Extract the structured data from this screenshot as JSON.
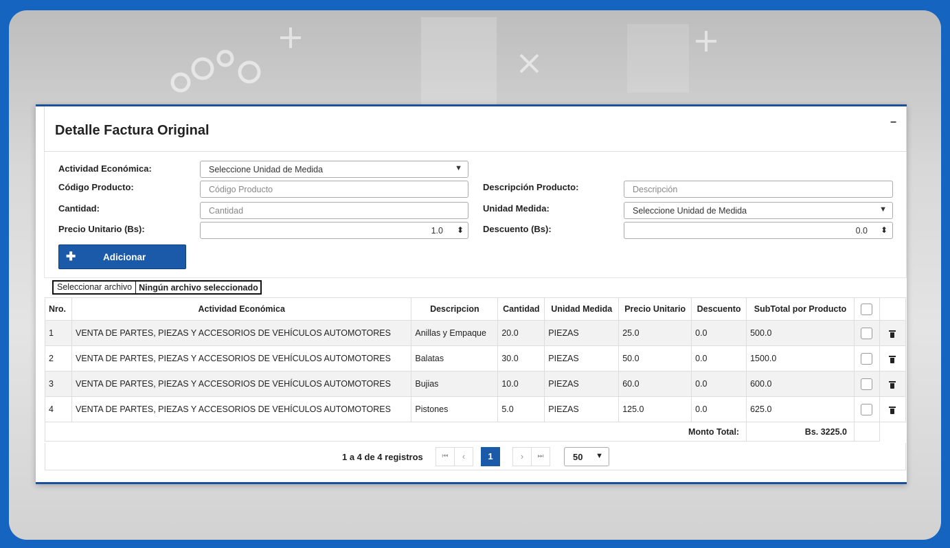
{
  "panel": {
    "title": "Detalle Factura Original",
    "collapse_label": "–"
  },
  "form": {
    "actividad": {
      "label": "Actividad Económica:",
      "value": "Seleccione Unidad de Medida"
    },
    "codigo": {
      "label": "Código Producto:",
      "placeholder": "Código Producto"
    },
    "descripcion": {
      "label": "Descripción Producto:",
      "placeholder": "Descripción"
    },
    "cantidad": {
      "label": "Cantidad:",
      "placeholder": "Cantidad"
    },
    "unidad": {
      "label": "Unidad Medida:",
      "value": "Seleccione Unidad de Medida"
    },
    "precio": {
      "label": "Precio Unitario (Bs):",
      "value": "1.0"
    },
    "descuento": {
      "label": "Descuento (Bs):",
      "value": "0.0"
    },
    "add_button": "Adicionar"
  },
  "file": {
    "button": "Seleccionar archivo",
    "status": "Ningún archivo seleccionado"
  },
  "table": {
    "headers": [
      "Nro.",
      "Actividad Económica",
      "Descripcion",
      "Cantidad",
      "Unidad Medida",
      "Precio Unitario",
      "Descuento",
      "SubTotal por Producto"
    ],
    "rows": [
      [
        "1",
        "VENTA DE PARTES, PIEZAS Y ACCESORIOS DE VEHÍCULOS AUTOMOTORES",
        "Anillas y Empaque",
        "20.0",
        "PIEZAS",
        "25.0",
        "0.0",
        "500.0"
      ],
      [
        "2",
        "VENTA DE PARTES, PIEZAS Y ACCESORIOS DE VEHÍCULOS AUTOMOTORES",
        "Balatas",
        "30.0",
        "PIEZAS",
        "50.0",
        "0.0",
        "1500.0"
      ],
      [
        "3",
        "VENTA DE PARTES, PIEZAS Y ACCESORIOS DE VEHÍCULOS AUTOMOTORES",
        "Bujias",
        "10.0",
        "PIEZAS",
        "60.0",
        "0.0",
        "600.0"
      ],
      [
        "4",
        "VENTA DE PARTES, PIEZAS Y ACCESORIOS DE VEHÍCULOS AUTOMOTORES",
        "Pistones",
        "5.0",
        "PIEZAS",
        "125.0",
        "0.0",
        "625.0"
      ]
    ],
    "total_label": "Monto Total:",
    "total_value": "Bs. 3225.0"
  },
  "pager": {
    "info": "1 a 4 de 4 registros",
    "first": "⏮",
    "prev": "‹",
    "current": "1",
    "next": "›",
    "last": "⏭",
    "page_size": "50"
  }
}
